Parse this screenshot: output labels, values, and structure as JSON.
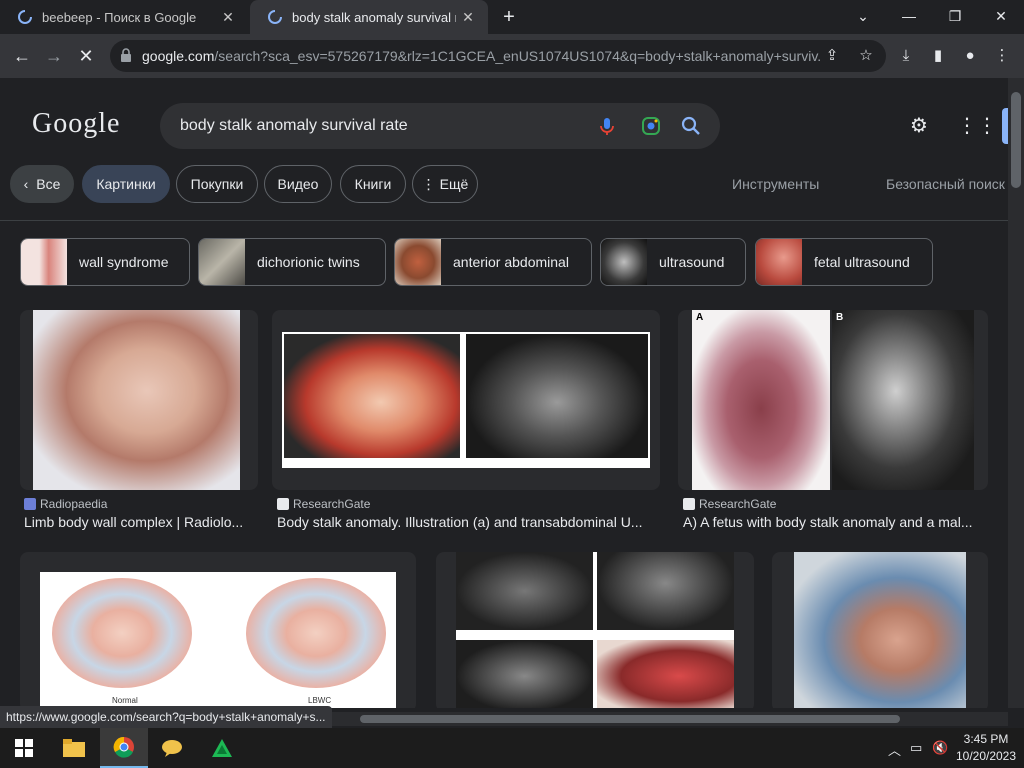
{
  "tabs": [
    {
      "title": "beebeep - Поиск в Google"
    },
    {
      "title": "body stalk anomaly survival rate"
    }
  ],
  "address": {
    "domain": "google.com",
    "path": "/search?sca_esv=575267179&rlz=1C1GCEA_enUS1074US1074&q=body+stalk+anomaly+surviv..."
  },
  "search": {
    "logo": "Google",
    "query": "body stalk anomaly survival rate"
  },
  "filters": {
    "back_all": "Все",
    "items": [
      "Картинки",
      "Покупки",
      "Видео",
      "Книги",
      "Ещё"
    ],
    "tools": "Инструменты",
    "safe_search": "Безопасный поиск"
  },
  "related": [
    {
      "label": "wall syndrome"
    },
    {
      "label": "dichorionic twins"
    },
    {
      "label": "anterior abdominal"
    },
    {
      "label": "ultrasound"
    },
    {
      "label": "fetal ultrasound"
    }
  ],
  "results": [
    {
      "source": "Radiopaedia",
      "title": "Limb body wall complex | Radiolo..."
    },
    {
      "source": "ResearchGate",
      "title": "Body stalk anomaly. Illustration (a) and transabdominal U..."
    },
    {
      "source": "ResearchGate",
      "title": "A) A fetus with body stalk anomaly and a mal..."
    }
  ],
  "image_labels": {
    "a": "A",
    "b": "B",
    "normal": "Normal",
    "lbwc": "LBWC"
  },
  "status_url": "https://www.google.com/search?q=body+stalk+anomaly+s...",
  "taskbar": {
    "time": "3:45 PM",
    "date": "10/20/2023"
  },
  "colors": {
    "accent_blue": "#8ab4f8",
    "background": "#202124"
  }
}
